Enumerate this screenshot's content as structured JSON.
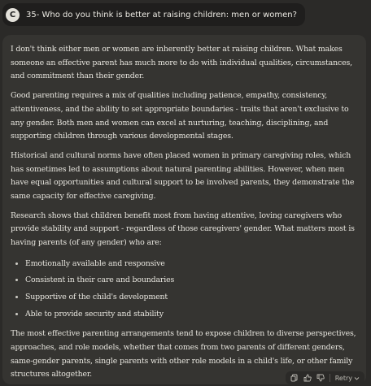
{
  "user": {
    "avatar_letter": "C",
    "message": "35- Who do you think is better at raising children: men or women?"
  },
  "response": {
    "paragraphs": [
      "I don't think either men or women are inherently better at raising children. What makes someone an effective parent has much more to do with individual qualities, circumstances, and commitment than their gender.",
      "Good parenting requires a mix of qualities including patience, empathy, consistency, attentiveness, and the ability to set appropriate boundaries - traits that aren't exclusive to any gender. Both men and women can excel at nurturing, teaching, disciplining, and supporting children through various developmental stages.",
      "Historical and cultural norms have often placed women in primary caregiving roles, which has sometimes led to assumptions about natural parenting abilities. However, when men have equal opportunities and cultural support to be involved parents, they demonstrate the same capacity for effective caregiving.",
      "Research shows that children benefit most from having attentive, loving caregivers who provide stability and support - regardless of those caregivers' gender. What matters most is having parents (of any gender) who are:"
    ],
    "bullets": [
      "Emotionally available and responsive",
      "Consistent in their care and boundaries",
      "Supportive of the child's development",
      "Able to provide security and stability"
    ],
    "closing": "The most effective parenting arrangements tend to expose children to diverse perspectives, approaches, and role models, whether that comes from two parents of different genders, same-gender parents, single parents with other role models in a child's life, or other family structures altogether."
  },
  "actions": {
    "copy_icon": "copy-icon",
    "thumbs_up_icon": "thumbs-up-icon",
    "thumbs_down_icon": "thumbs-down-icon",
    "retry_label": "Retry",
    "retry_chevron": "chevron-down-icon"
  }
}
